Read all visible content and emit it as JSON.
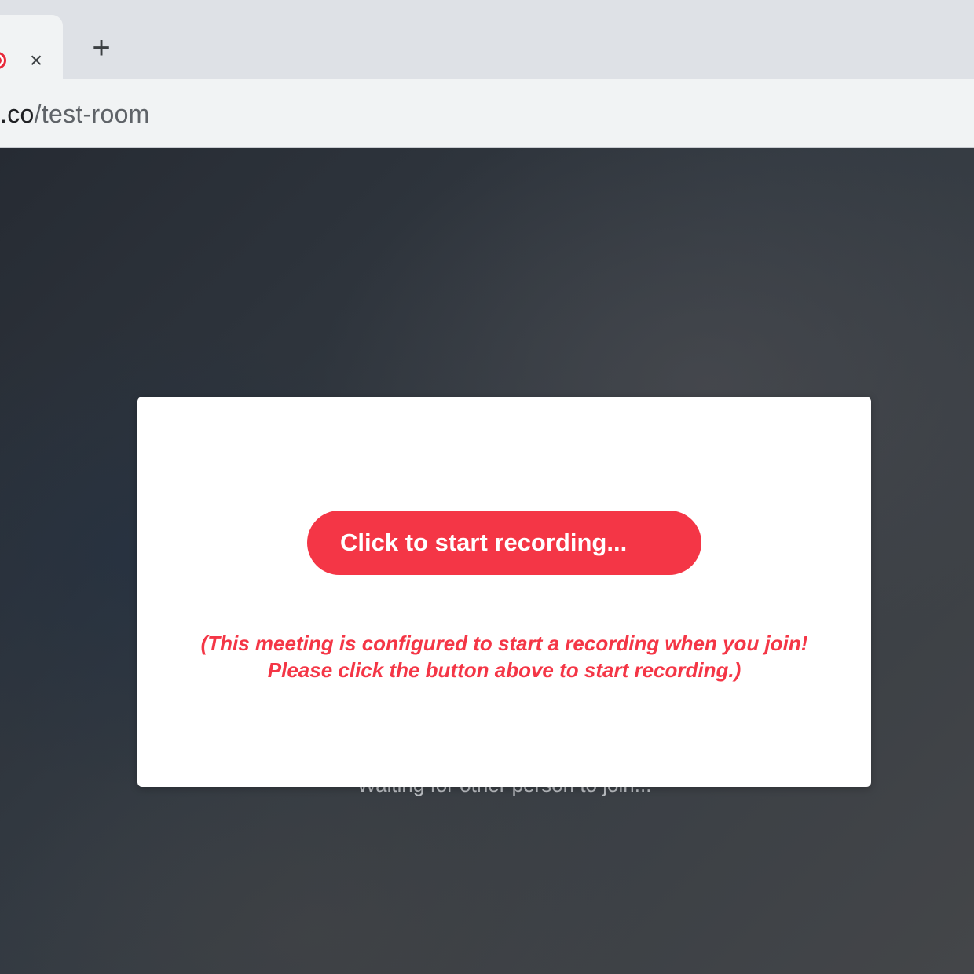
{
  "browser": {
    "tab": {
      "close_glyph": "×",
      "record_icon": "record-indicator-icon",
      "record_color": "#e8293a"
    },
    "new_tab_glyph": "+",
    "address": {
      "domain_fragment": ".co",
      "path": "/test-room"
    }
  },
  "page": {
    "background_text": "Waiting for other person to join...",
    "modal": {
      "button_label": "Click to start recording...",
      "notice_line1": "(This meeting is configured to start a recording when you join!",
      "notice_line2": "Please click the button above to start recording.)",
      "accent_color": "#f43646"
    }
  }
}
